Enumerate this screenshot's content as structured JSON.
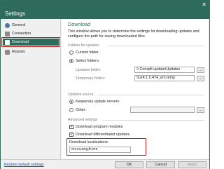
{
  "window": {
    "title": "Settings",
    "close_glyph": "✕"
  },
  "sidebar": {
    "items": [
      {
        "label": "General",
        "icon": "gear-icon",
        "icon_color": "#4d7aa6",
        "selected": false
      },
      {
        "label": "Connection",
        "icon": "connection-icon",
        "icon_color": "#8a8a8a",
        "selected": false
      },
      {
        "label": "Download",
        "icon": "download-icon",
        "icon_color": "#ffffff",
        "selected": true
      },
      {
        "label": "Reports",
        "icon": "reports-icon",
        "icon_color": "#8a8a8a",
        "selected": false
      }
    ]
  },
  "main": {
    "title": "Download",
    "description": "This window allows you to determine the settings for downloading updates and configure the path for saving downloaded files.",
    "folders_section": "Folders for updates",
    "current_folder_label": "Current folder",
    "select_folders_label": "Select folders:",
    "updates_folder_label": "Updates folder:",
    "updates_folder_value": "\\\\ Complit update\\Updates",
    "temporary_folder_label": "Temporary folder:",
    "temporary_folder_value": "\\\\ux4.1.0.474_en\\ temp",
    "browse_label": "...",
    "updates_source_section": "Updates source",
    "kaspersky_servers_label": "Kaspersky update servers",
    "other_label": "Other:",
    "advanced_section": "Advanced settings",
    "download_modules_label": "Download program modules",
    "download_diff_label": "Download differentiated updates",
    "localizations_label": "Download localizations:",
    "localizations_value": "en;cs;ang;fr;ore"
  },
  "footer": {
    "restore_label": "Restore default settings",
    "ok_label": "OK",
    "cancel_label": "Cancel",
    "apply_label": "Apply"
  },
  "colors": {
    "accent": "#2e6b5c",
    "highlight_border": "#d01818",
    "link": "#1a56b0"
  }
}
